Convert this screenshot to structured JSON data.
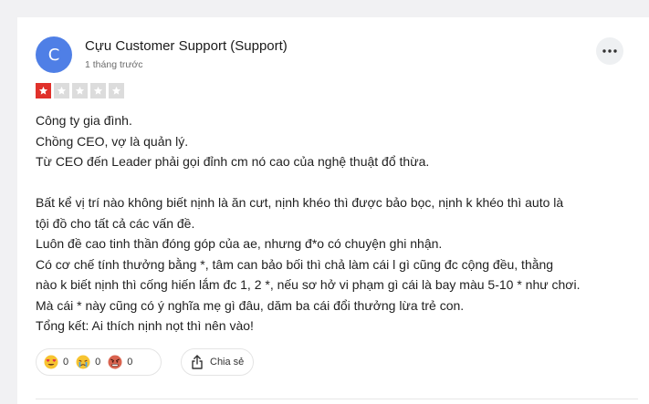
{
  "review": {
    "avatar_letter": "C",
    "author": "Cựu Customer Support (Support)",
    "time": "1 tháng trước",
    "rating": 1,
    "rating_max": 5,
    "lines": [
      "Công ty gia đình.",
      "Chồng CEO, vợ là quản lý.",
      "Từ CEO đến Leader phải gọi đỉnh cm nó cao của nghệ thuật đổ thừa.",
      "",
      "Bất kể vị trí nào không biết nịnh là ăn cưt, nịnh khéo thì được bảo bọc, nịnh k khéo thì auto là",
      "tội đồ cho tất cả các vấn đề.",
      "Luôn đề cao tinh thần đóng góp của ae, nhưng đ*o có chuyện ghi nhận.",
      "Có cơ chế tính thưởng bằng *, tâm can bảo bối thì chả làm cái l gì cũng đc cộng đều, thằng",
      "nào k biết nịnh thì cống hiến lắm đc 1, 2 *, nếu sơ hở vi phạm gì cái là bay màu 5-10 * như chơi.",
      "Mà cái * này cũng có ý nghĩa mẹ gì đâu, dăm ba cái đổi thưởng lừa trẻ con.",
      "Tổng kết: Ai thích nịnh nọt thì nên vào!"
    ]
  },
  "reactions": {
    "love": {
      "icon": "heart-eyes-emoji-icon",
      "count": "0"
    },
    "sad": {
      "icon": "crying-face-emoji-icon",
      "count": "0"
    },
    "angry": {
      "icon": "angry-face-emoji-icon",
      "count": "0"
    }
  },
  "share": {
    "label": "Chia sẻ",
    "icon": "share-icon"
  },
  "colors": {
    "avatar": "#4f7fe6",
    "star_on": "#e0312b",
    "star_off": "#dcdcdc",
    "page_bg": "#f1f1f3"
  }
}
